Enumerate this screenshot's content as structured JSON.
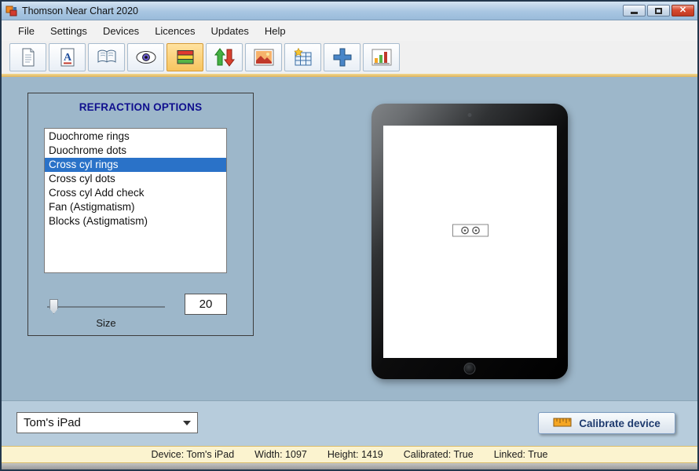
{
  "window": {
    "title": "Thomson Near Chart 2020"
  },
  "menu": {
    "items": [
      "File",
      "Settings",
      "Devices",
      "Licences",
      "Updates",
      "Help"
    ]
  },
  "toolbar": {
    "buttons": [
      "document-icon",
      "font-icon",
      "book-icon",
      "eye-icon",
      "duochrome-bars-icon",
      "sort-arrows-icon",
      "image-icon",
      "grid-star-icon",
      "cross-icon",
      "graph-icon"
    ],
    "active_index": 4
  },
  "refraction": {
    "title": "REFRACTION OPTIONS",
    "options": [
      "Duochrome rings",
      "Duochrome dots",
      "Cross cyl rings",
      "Cross cyl dots",
      "Cross cyl Add check",
      "Fan (Astigmatism)",
      "Blocks (Astigmatism)"
    ],
    "selected_index": 2,
    "size_label": "Size",
    "size_value": "20"
  },
  "device_bar": {
    "selected_device": "Tom's iPad",
    "calibrate_label": "Calibrate device"
  },
  "status": {
    "items": [
      "Device: Tom's iPad",
      "Width: 1097",
      "Height: 1419",
      "Calibrated: True",
      "Linked: True"
    ]
  },
  "colors": {
    "selection_blue": "#2a72c8",
    "panel_title_navy": "#10108e",
    "main_background": "#9db7ca",
    "status_background": "#fbf3cf",
    "gold_accent": "#e0b75e",
    "toolbar_active": "#f7c45f"
  }
}
